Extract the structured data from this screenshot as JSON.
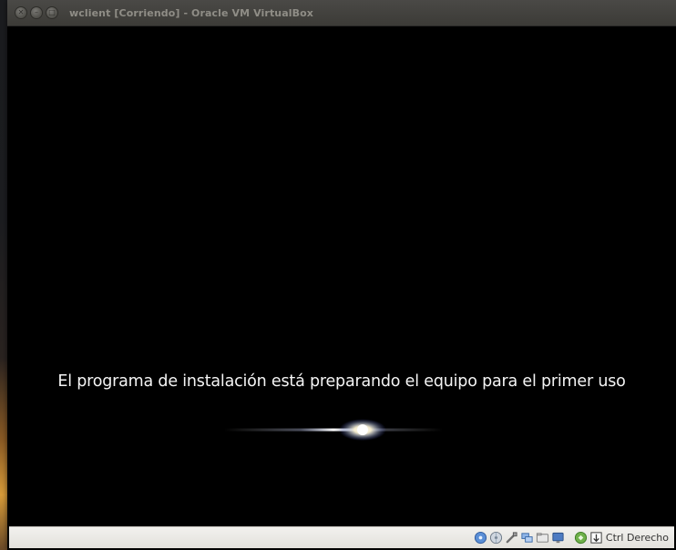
{
  "window": {
    "title": "wclient [Corriendo] - Oracle VM VirtualBox",
    "buttons": [
      "close",
      "minimize",
      "maximize"
    ]
  },
  "guest_screen": {
    "message": "El programa de instalación está preparando el equipo para el primer uso"
  },
  "statusbar": {
    "icons": [
      "hard-disk-icon",
      "optical-drive-icon",
      "usb-icon",
      "network-icon",
      "shared-folder-icon",
      "display-icon",
      "mouse-integration-icon",
      "keyboard-capture-icon"
    ],
    "host_key_label": "Ctrl Derecho"
  }
}
